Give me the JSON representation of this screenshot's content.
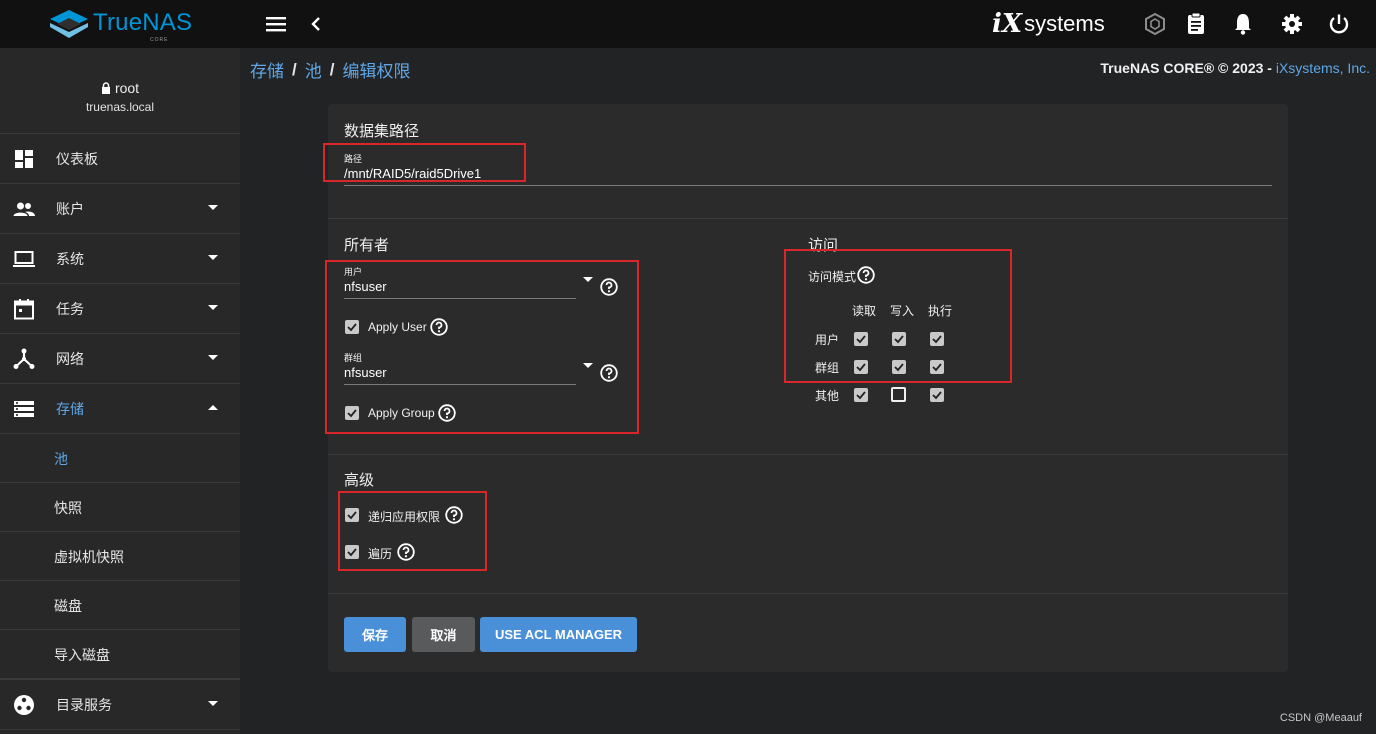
{
  "topbar": {
    "brand_name": "TrueNAS",
    "brand_sub": "CORE",
    "vendor_ix": "iX",
    "vendor_systems": "systems",
    "icons": [
      "menu-icon",
      "back-chevron-icon",
      "truecommand-icon",
      "task-manager-icon",
      "notifications-icon",
      "settings-icon",
      "power-icon"
    ]
  },
  "user": {
    "name": "root",
    "host": "truenas.local"
  },
  "sidebar": {
    "items": [
      {
        "label": "仪表板",
        "icon": "dashboard-icon",
        "caret": false
      },
      {
        "label": "账户",
        "icon": "accounts-icon",
        "caret": true
      },
      {
        "label": "系统",
        "icon": "laptop-icon",
        "caret": true
      },
      {
        "label": "任务",
        "icon": "calendar-icon",
        "caret": true
      },
      {
        "label": "网络",
        "icon": "network-icon",
        "caret": true
      },
      {
        "label": "存储",
        "icon": "storage-icon",
        "caret": true,
        "expanded": true
      }
    ],
    "storage_sub": [
      "池",
      "快照",
      "虚拟机快照",
      "磁盘",
      "导入磁盘"
    ],
    "directory_services": "目录服务"
  },
  "breadcrumb": {
    "c1": "存储",
    "c2": "池",
    "c3": "编辑权限",
    "sep": "/"
  },
  "copyright": {
    "text": "TrueNAS CORE® © 2023 - ",
    "link": "iXsystems, Inc."
  },
  "form": {
    "dataset_section": "数据集路径",
    "path_label": "路径",
    "path_value": "/mnt/RAID5/raid5Drive1",
    "owner_section": "所有者",
    "user_label": "用户",
    "user_value": "nfsuser",
    "apply_user": "Apply User",
    "group_label": "群组",
    "group_value": "nfsuser",
    "apply_group": "Apply Group",
    "access_section": "访问",
    "access_mode": "访问模式",
    "perm_cols": [
      "读取",
      "写入",
      "执行"
    ],
    "perm_rows": [
      {
        "label": "用户",
        "values": [
          true,
          true,
          true
        ]
      },
      {
        "label": "群组",
        "values": [
          true,
          true,
          true
        ]
      },
      {
        "label": "其他",
        "values": [
          true,
          false,
          true
        ]
      }
    ],
    "advanced_section": "高级",
    "recursive": "递归应用权限",
    "traverse": "遍历",
    "apply_user_checked": true,
    "apply_group_checked": true,
    "recursive_checked": true,
    "traverse_checked": true
  },
  "buttons": {
    "save": "保存",
    "cancel": "取消",
    "acl": "USE ACL MANAGER"
  },
  "watermark": "CSDN @Meaauf",
  "colors": {
    "accent": "#4a90d9",
    "link": "#5fa7e6",
    "highlight": "#d8262a",
    "topbar": "#111112",
    "sidebar": "#282829"
  }
}
